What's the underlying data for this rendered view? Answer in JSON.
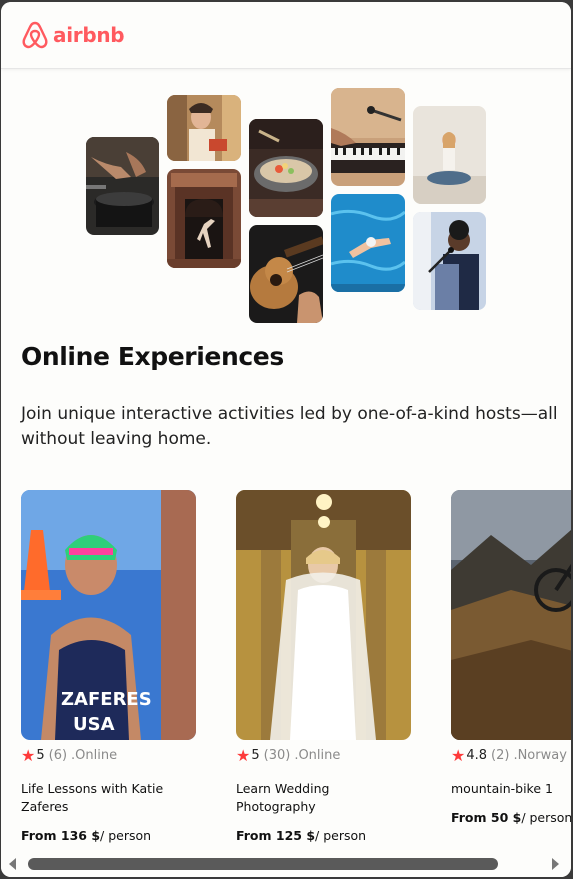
{
  "brand": {
    "name": "airbnb",
    "color": "#ff5a5f"
  },
  "hero": {
    "heading": "Online Experiences",
    "intro": "Join unique interactive activities led by one-of-a-kind hosts—all without leaving home."
  },
  "gallery": [
    {
      "icon": "cooking-photo"
    },
    {
      "icon": "chef-photo"
    },
    {
      "icon": "dancer-photo"
    },
    {
      "icon": "food-bowl-photo"
    },
    {
      "icon": "guitar-photo"
    },
    {
      "icon": "keyboard-photo"
    },
    {
      "icon": "swimmer-photo"
    },
    {
      "icon": "yoga-photo"
    },
    {
      "icon": "singer-photo"
    }
  ],
  "cards": [
    {
      "rating": "5",
      "count": "(6)",
      "location": ".Online",
      "title": "Life Lessons with Katie Zaferes",
      "price_prefix": "From 136 $",
      "price_suffix": "/ person"
    },
    {
      "rating": "5",
      "count": "(30)",
      "location": ".Online",
      "title": "Learn Wedding Photography",
      "price_prefix": "From 125 $",
      "price_suffix": "/ person"
    },
    {
      "rating": "4.8",
      "count": "(2)",
      "location": ".Norway",
      "title": "mountain-bike 1",
      "price_prefix": "From 50 $",
      "price_suffix": "/ person"
    }
  ],
  "colors": {
    "star": "#fe3a3a",
    "muted": "#8a8a8a"
  }
}
